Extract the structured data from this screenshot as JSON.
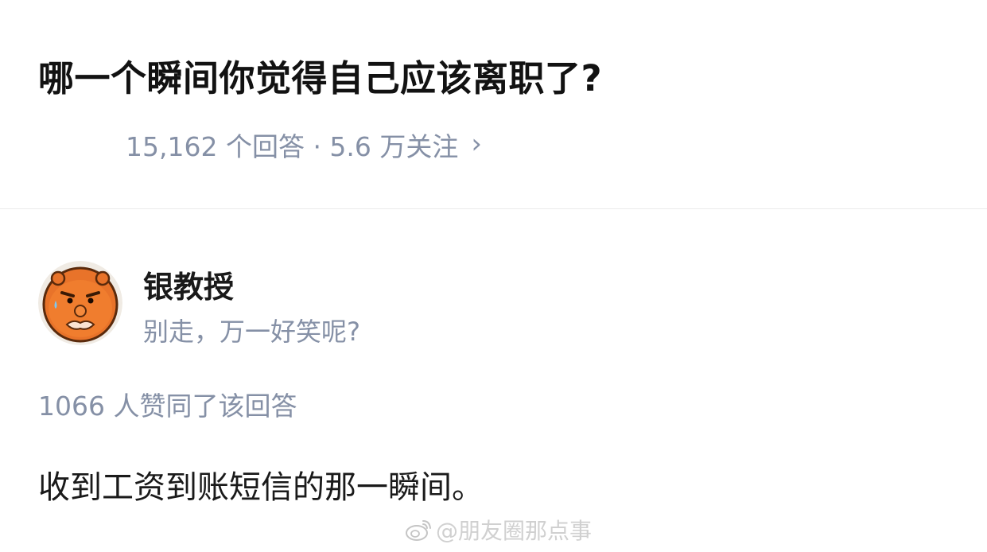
{
  "question": {
    "title": "哪一个瞬间你觉得自己应该离职了?",
    "meta": "15,162 个回答 · 5.6 万关注",
    "chevron": "›"
  },
  "author": {
    "name": "银教授",
    "bio": "别走，万一好笑呢?",
    "avatar_icon": "orange-cartoon-face-avatar",
    "avatar_color": "#e8732a"
  },
  "answer": {
    "votes": "1066 人赞同了该回答",
    "content": "收到工资到账短信的那一瞬间。"
  },
  "watermark": {
    "text": "@朋友圈那点事",
    "icon": "weibo-icon"
  },
  "colors": {
    "title": "#121212",
    "meta": "#8590a6",
    "divider": "#ebebeb"
  }
}
